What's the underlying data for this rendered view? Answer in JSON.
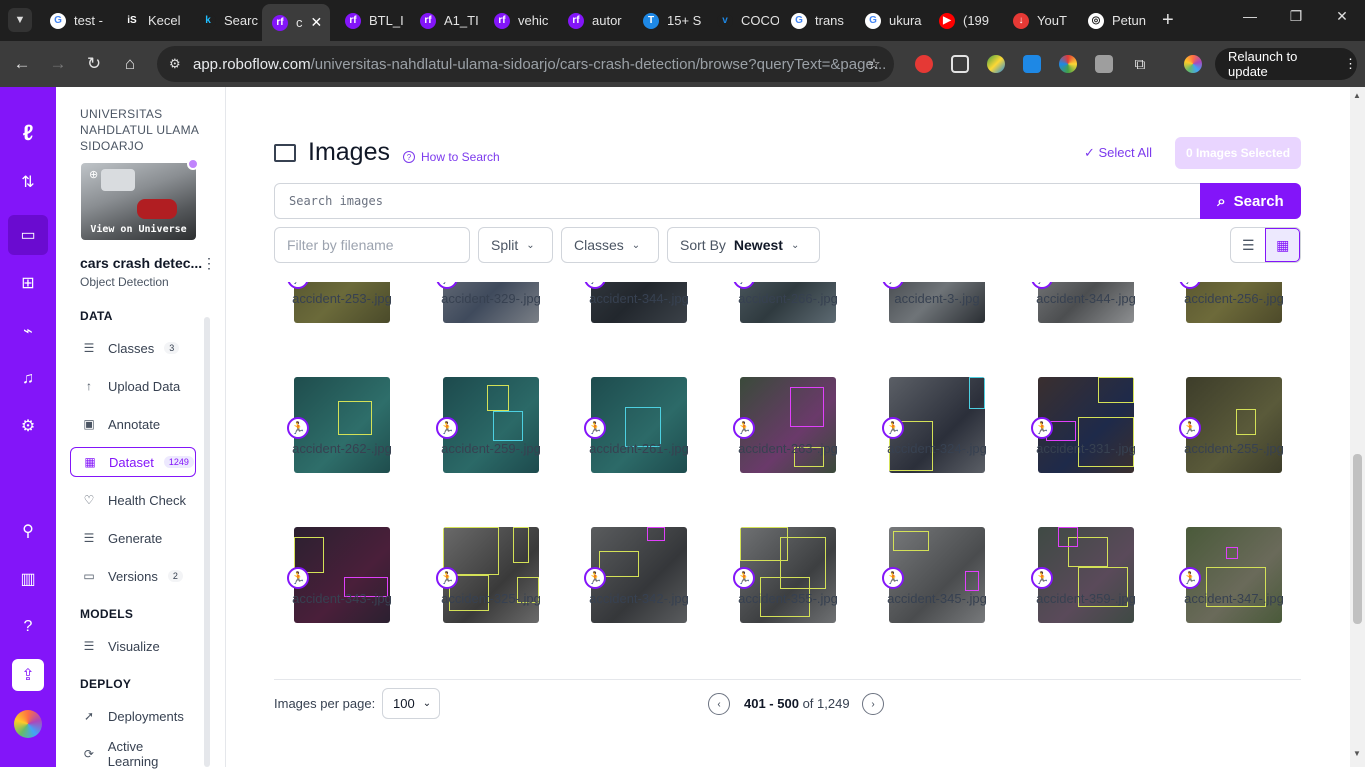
{
  "browser": {
    "tabs": [
      {
        "title": "test -",
        "fav": "G",
        "color": "#4285f4",
        "bg": "#fff"
      },
      {
        "title": "Kecel",
        "fav": "iS",
        "color": "#fff",
        "bg": "#1f1f1f"
      },
      {
        "title": "Searc",
        "fav": "k",
        "color": "#20beff",
        "bg": "#1f1f1f"
      },
      {
        "title": "c",
        "fav": "rf",
        "color": "#fff",
        "bg": "#8315f9"
      },
      {
        "title": "BTL_I",
        "fav": "rf",
        "color": "#fff",
        "bg": "#8315f9"
      },
      {
        "title": "A1_TI",
        "fav": "rf",
        "color": "#fff",
        "bg": "#8315f9"
      },
      {
        "title": "vehic",
        "fav": "rf",
        "color": "#fff",
        "bg": "#8315f9"
      },
      {
        "title": "autor",
        "fav": "rf",
        "color": "#fff",
        "bg": "#8315f9"
      },
      {
        "title": "15+ S",
        "fav": "T",
        "color": "#fff",
        "bg": "#1e88e5"
      },
      {
        "title": "COCO",
        "fav": "v",
        "color": "#1e88e5",
        "bg": "#1f1f1f"
      },
      {
        "title": "trans",
        "fav": "G",
        "color": "#4285f4",
        "bg": "#fff"
      },
      {
        "title": "ukura",
        "fav": "G",
        "color": "#4285f4",
        "bg": "#fff"
      },
      {
        "title": "(199",
        "fav": "▶",
        "color": "#fff",
        "bg": "#ff0000"
      },
      {
        "title": "YouT",
        "fav": "↓",
        "color": "#fff",
        "bg": "#e53935"
      },
      {
        "title": "Petun",
        "fav": "◎",
        "color": "#1f1f1f",
        "bg": "#fff"
      }
    ],
    "new_tab": "+",
    "url_host": "app.roboflow.com",
    "url_path": "/universitas-nahdlatul-ulama-sidoarjo/cars-crash-detection/browse?queryText=&page...",
    "relaunch_label": "Relaunch to update"
  },
  "sidebar": {
    "workspace": "UNIVERSITAS NAHDLATUL ULAMA SIDOARJO",
    "view_on_universe": "View on Universe",
    "project_name": "cars crash detec...",
    "project_type": "Object Detection",
    "sections": {
      "data": "DATA",
      "models": "MODELS",
      "deploy": "DEPLOY"
    },
    "data_items": [
      {
        "label": "Classes",
        "icon": "☰",
        "badge": "3",
        "name": "classes"
      },
      {
        "label": "Upload Data",
        "icon": "↑",
        "badge": "",
        "name": "upload-data"
      },
      {
        "label": "Annotate",
        "icon": "▣",
        "badge": "",
        "name": "annotate"
      },
      {
        "label": "Dataset",
        "icon": "▦",
        "badge": "1249",
        "name": "dataset"
      },
      {
        "label": "Health Check",
        "icon": "♡",
        "badge": "",
        "name": "health-check"
      },
      {
        "label": "Generate",
        "icon": "☰",
        "badge": "",
        "name": "generate"
      },
      {
        "label": "Versions",
        "icon": "▭",
        "badge": "2",
        "name": "versions"
      }
    ],
    "model_items": [
      {
        "label": "Visualize",
        "icon": "☰",
        "name": "visualize"
      }
    ],
    "deploy_items": [
      {
        "label": "Deployments",
        "icon": "➚",
        "name": "deployments"
      },
      {
        "label": "Active Learning",
        "icon": "⟳",
        "name": "active-learning"
      }
    ]
  },
  "main": {
    "title": "Images",
    "how_to_search": "How to Search",
    "select_all": "Select All",
    "images_selected": "0 Images Selected",
    "search_placeholder": "Search images",
    "search_button": "Search",
    "filter_placeholder": "Filter by filename",
    "split_label": "Split",
    "classes_label": "Classes",
    "sort_label": "Sort By",
    "sort_value": "Newest",
    "images": [
      "accident-253-.jpg",
      "accident-329-.jpg",
      "accident-344-.jpg",
      "accident-266-.jpg",
      "accident-3-.jpg",
      "accident-344-.jpg",
      "accident-256-.jpg",
      "accident-262-.jpg",
      "accident-259-.jpg",
      "accident-261-.jpg",
      "accident-263-.jpg",
      "accident-324-.jpg",
      "accident-331-.jpg",
      "accident-255-.jpg",
      "accident-343-.jpg",
      "accident-325-.jpg",
      "accident-342-.jpg",
      "accident-355-.jpg",
      "accident-345-.jpg",
      "accident-359-.jpg",
      "accident-347-.jpg"
    ],
    "per_page_label": "Images per page:",
    "per_page_value": "100",
    "range": "401 - 500",
    "of_total": "of 1,249"
  }
}
